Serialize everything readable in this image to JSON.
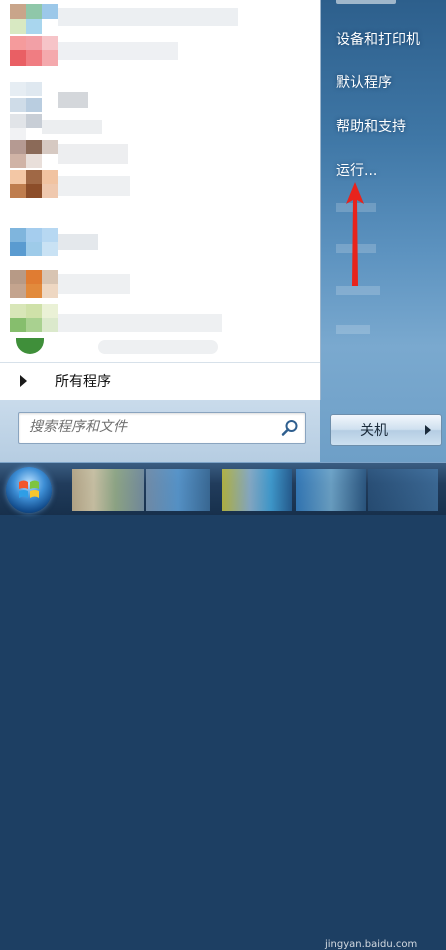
{
  "start_menu": {
    "all_programs_label": "所有程序",
    "search_placeholder": "搜索程序和文件",
    "right_items": [
      {
        "label": "设备和打印机"
      },
      {
        "label": "默认程序"
      },
      {
        "label": "帮助和支持"
      },
      {
        "label": "运行..."
      }
    ],
    "shutdown_label": "关机"
  },
  "colors": {
    "annotation_arrow": "#e8231c",
    "left_pane_bg": "#ffffff",
    "shutdown_text": "#1b2b3b"
  },
  "watermark": "jingyan.baidu.com"
}
